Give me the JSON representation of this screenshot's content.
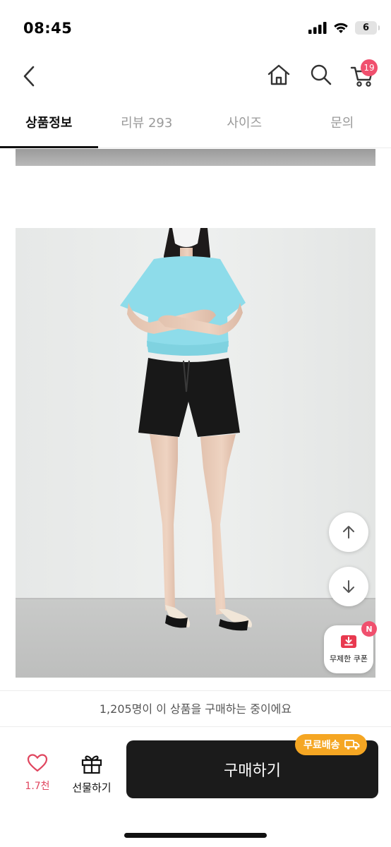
{
  "status_bar": {
    "time": "08:45",
    "battery": "6"
  },
  "header": {
    "cart_count": "19"
  },
  "tabs": [
    {
      "label": "상품정보"
    },
    {
      "label": "리뷰 293"
    },
    {
      "label": "사이즈"
    },
    {
      "label": "문의"
    }
  ],
  "floating": {
    "coupon_label": "무제한 쿠폰",
    "coupon_badge": "N"
  },
  "notice": {
    "text": "1,205명이 이 상품을 구매하는 중이에요"
  },
  "bottom_bar": {
    "like_count": "1.7천",
    "gift_label": "선물하기",
    "buy_label": "구매하기",
    "free_shipping": "무료배송"
  },
  "colors": {
    "accent": "#f0506e",
    "shipping": "#f5a623",
    "buy_button": "#1b1b1b"
  }
}
